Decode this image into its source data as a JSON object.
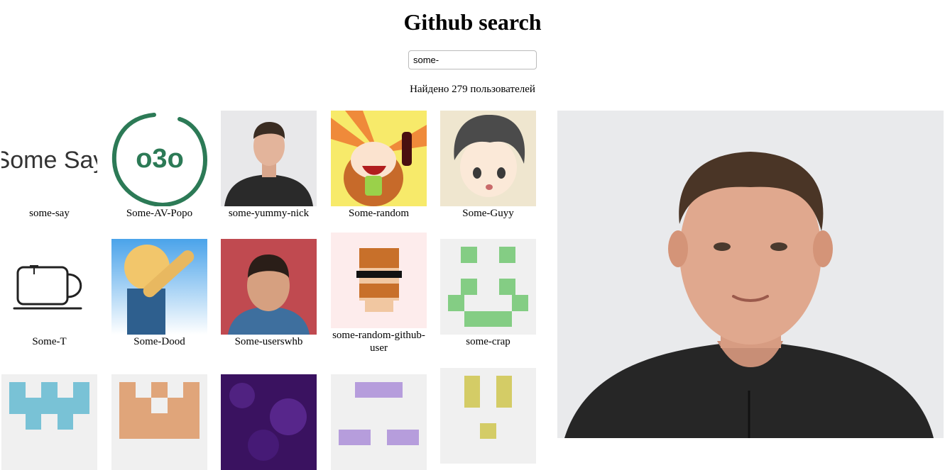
{
  "title": "Github search",
  "search": {
    "value": "some-",
    "placeholder": ""
  },
  "results_text": "Найдено 279 пользователей",
  "users": [
    {
      "login": "some-say",
      "avatar": "some-say-wordmark-avatar",
      "logo_text": "Some Say"
    },
    {
      "login": "Some-AV-Popo",
      "avatar": "green-circle-o3o-avatar",
      "logo_text": "o3o"
    },
    {
      "login": "some-yummy-nick",
      "avatar": "man-photo-avatar"
    },
    {
      "login": "Some-random",
      "avatar": "anime-girl-avatar"
    },
    {
      "login": "Some-Guyy",
      "avatar": "anime-boy-avatar"
    },
    {
      "login": "Some-T",
      "avatar": "teacup-avatar"
    },
    {
      "login": "Some-Dood",
      "avatar": "dab-figure-avatar"
    },
    {
      "login": "Some-userswhb",
      "avatar": "child-photo-avatar"
    },
    {
      "login": "some-random-github-user",
      "avatar": "pixel-hipster-avatar"
    },
    {
      "login": "some-crap",
      "avatar": "green-identicon-avatar"
    },
    {
      "login": "",
      "avatar": "blue-identicon-avatar"
    },
    {
      "login": "",
      "avatar": "orange-identicon-avatar"
    },
    {
      "login": "",
      "avatar": "purple-galaxy-avatar"
    },
    {
      "login": "",
      "avatar": "lavender-identicon-avatar"
    },
    {
      "login": "",
      "avatar": "olive-identicon-avatar"
    }
  ],
  "selected_user_photo": "man-portrait-large-photo",
  "colors": {
    "identicon_bg": "#f0f0f0",
    "green": "#84cd84",
    "blue": "#79c2d6",
    "orange": "#e0a57a",
    "lavender": "#b69ddc",
    "olive": "#d4cc66"
  }
}
